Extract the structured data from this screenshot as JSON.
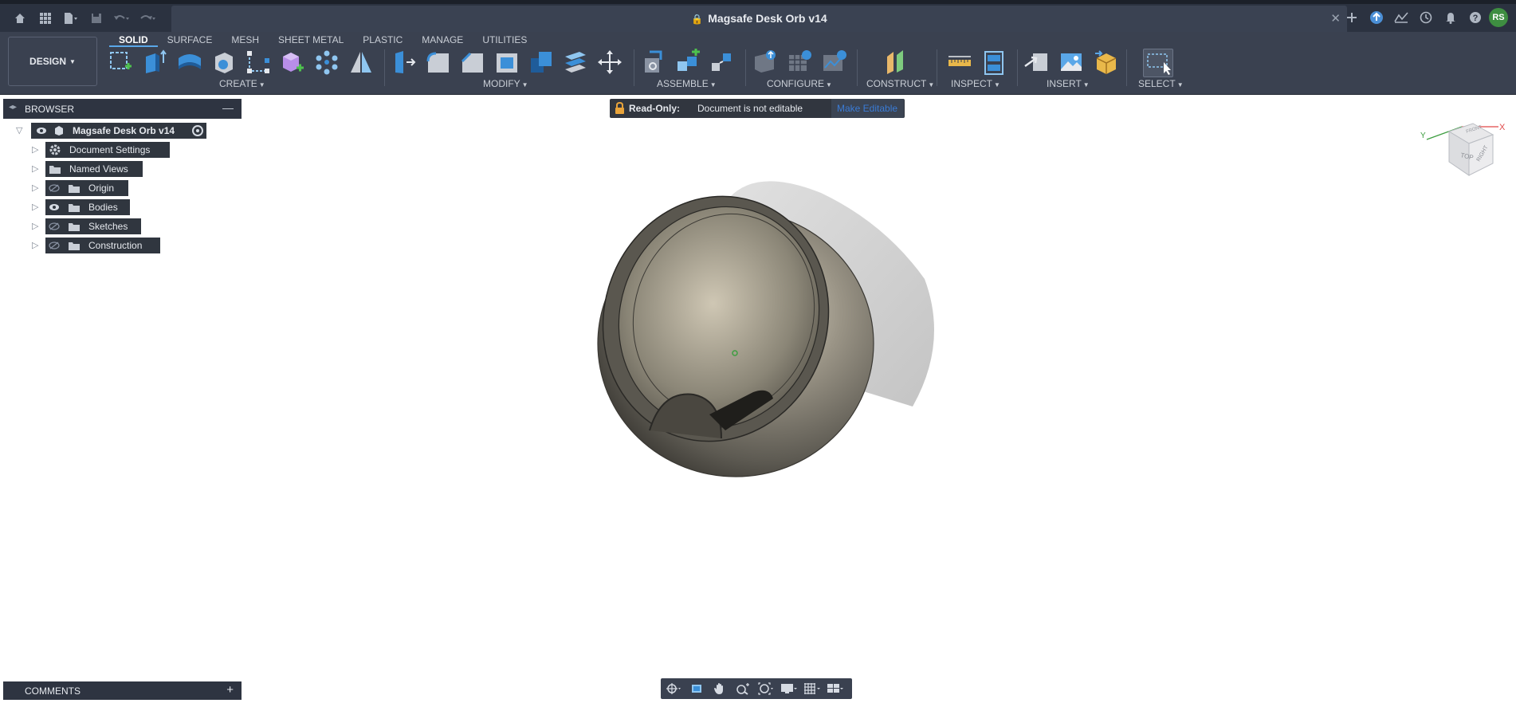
{
  "titlebar": {
    "document_title": "Magsafe Desk Orb v14",
    "lock_glyph": "🔒",
    "close_glyph": "✕",
    "left_icons": [
      "home-icon",
      "grid-icon",
      "file-icon",
      "save-icon",
      "undo-icon",
      "redo-icon"
    ],
    "right_icons": [
      "plus-icon",
      "extension-icon",
      "activity-icon",
      "clock-icon",
      "bell-icon",
      "help-icon"
    ],
    "user_initials": "RS"
  },
  "toolbar": {
    "workspace_label": "DESIGN",
    "tabs": [
      "SOLID",
      "SURFACE",
      "MESH",
      "SHEET METAL",
      "PLASTIC",
      "MANAGE",
      "UTILITIES"
    ],
    "active_tab": "SOLID",
    "groups": {
      "create": "CREATE",
      "modify": "MODIFY",
      "assemble": "ASSEMBLE",
      "configure": "CONFIGURE",
      "construct": "CONSTRUCT",
      "inspect": "INSPECT",
      "insert": "INSERT",
      "select": "SELECT"
    }
  },
  "browser": {
    "title": "BROWSER",
    "root": "Magsafe Desk Orb v14",
    "items": [
      {
        "label": "Document Settings",
        "icon": "gear-icon"
      },
      {
        "label": "Named Views",
        "icon": "folder-icon"
      },
      {
        "label": "Origin",
        "icon": "folder-icon",
        "visibility": "hidden"
      },
      {
        "label": "Bodies",
        "icon": "folder-icon",
        "visibility": "visible"
      },
      {
        "label": "Sketches",
        "icon": "folder-icon",
        "visibility": "hidden"
      },
      {
        "label": "Construction",
        "icon": "folder-icon",
        "visibility": "hidden"
      }
    ]
  },
  "banner": {
    "label": "Read-Only:",
    "message": "Document is not editable",
    "action": "Make Editable"
  },
  "viewcube": {
    "top": "TOP",
    "right": "RIGHT",
    "front": "FRONT",
    "axis_x": "X",
    "axis_y": "Y"
  },
  "comments": {
    "title": "COMMENTS",
    "add": "+"
  },
  "colors": {
    "accent": "#5aa7e8",
    "chrome_dark": "#2b3240",
    "toolbar": "#3a4150",
    "body_dark": "#4a4740",
    "body_light": "#9a9486"
  }
}
